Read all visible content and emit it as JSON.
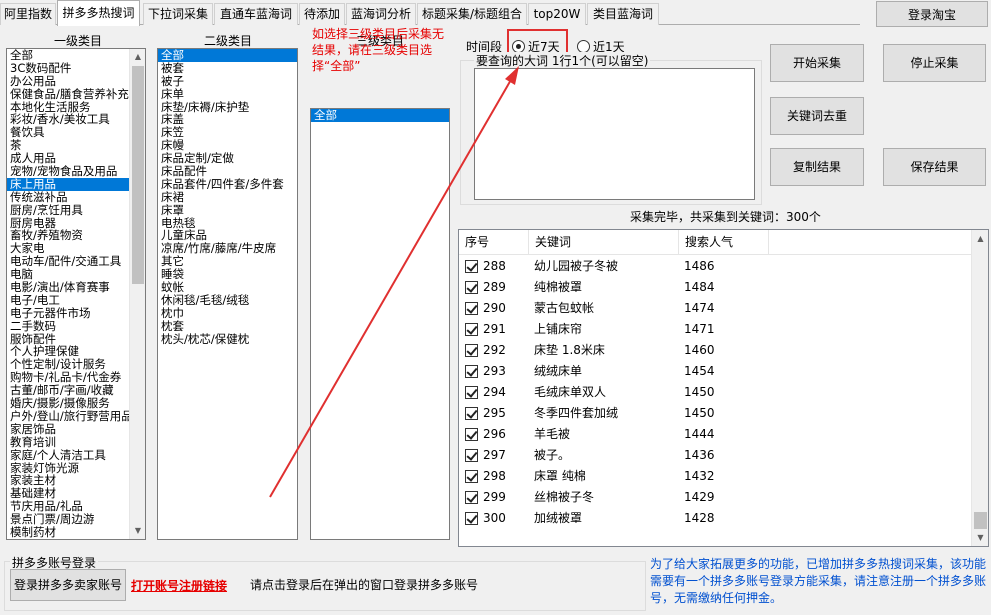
{
  "tabs": [
    "阿里指数",
    "拼多多热搜词",
    "下拉词采集",
    "直通车蓝海词",
    "待添加",
    "蓝海词分析",
    "标题采集/标题组合",
    "top20W",
    "类目蓝海词"
  ],
  "active_tab": 1,
  "login_taobao": "登录淘宝",
  "category": {
    "level1_label": "一级类目",
    "level2_label": "二级类目",
    "level3_label": "三级类目",
    "level1_items": [
      "全部",
      "3C数码配件",
      "办公用品",
      "保健食品/膳食营养补充",
      "本地化生活服务",
      "彩妆/香水/美妆工具",
      "餐饮具",
      "茶",
      "成人用品",
      "宠物/宠物食品及用品",
      "床上用品",
      "传统滋补品",
      "厨房/烹饪用具",
      "厨房电器",
      "畜牧/养殖物资",
      "大家电",
      "电动车/配件/交通工具",
      "电脑",
      "电影/演出/体育赛事",
      "电子/电工",
      "电子元器件市场",
      "二手数码",
      "服饰配件",
      "个人护理保健",
      "个性定制/设计服务",
      "购物卡/礼品卡/代金券",
      "古董/邮币/字画/收藏",
      "婚庆/摄影/摄像服务",
      "户外/登山/旅行野营用品",
      "家居饰品",
      "教育培训",
      "家庭/个人清洁工具",
      "家装灯饰光源",
      "家装主材",
      "基础建材",
      "节庆用品/礼品",
      "景点门票/周边游",
      "模制药材"
    ],
    "level1_selected": 10,
    "level2_items": [
      "全部",
      "被套",
      "被子",
      "床单",
      "床垫/床褥/床护垫",
      "床盖",
      "床笠",
      "床幔",
      "床品定制/定做",
      "床品配件",
      "床品套件/四件套/多件套",
      "床裙",
      "床罩",
      "电热毯",
      "儿童床品",
      "凉席/竹席/藤席/牛皮席",
      "其它",
      "睡袋",
      "蚊帐",
      "休闲毯/毛毯/绒毯",
      "枕巾",
      "枕套",
      "枕头/枕芯/保健枕"
    ],
    "level2_selected": 0,
    "level3_items": [
      "全部"
    ],
    "level3_selected": 0,
    "hint": "如选择三级类目后采集无结果，请在三级类目选择“全部”"
  },
  "time": {
    "label": "时间段",
    "opt1": "近7天",
    "opt2": "近1天",
    "selected": 0
  },
  "query": {
    "title": "要查询的大词 1行1个(可以留空)",
    "value": ""
  },
  "buttons": {
    "start": "开始采集",
    "stop": "停止采集",
    "dedupe": "关键词去重",
    "copy": "复制结果",
    "save": "保存结果"
  },
  "status": "采集完毕，共采集到关键词：300个",
  "table": {
    "headers": [
      "序号",
      "关键词",
      "搜索人气"
    ],
    "rows": [
      {
        "no": "288",
        "kw": "幼儿园被子冬被",
        "pop": "1486"
      },
      {
        "no": "289",
        "kw": "纯棉被罩",
        "pop": "1484"
      },
      {
        "no": "290",
        "kw": "蒙古包蚊帐",
        "pop": "1474"
      },
      {
        "no": "291",
        "kw": "上铺床帘",
        "pop": "1471"
      },
      {
        "no": "292",
        "kw": "床垫 1.8米床",
        "pop": "1460"
      },
      {
        "no": "293",
        "kw": "绒绒床单",
        "pop": "1454"
      },
      {
        "no": "294",
        "kw": "毛绒床单双人",
        "pop": "1450"
      },
      {
        "no": "295",
        "kw": "冬季四件套加绒",
        "pop": "1450"
      },
      {
        "no": "296",
        "kw": "羊毛被",
        "pop": "1444"
      },
      {
        "no": "297",
        "kw": "被子。",
        "pop": "1436"
      },
      {
        "no": "298",
        "kw": "床罩 纯棉",
        "pop": "1432"
      },
      {
        "no": "299",
        "kw": "丝棉被子冬",
        "pop": "1429"
      },
      {
        "no": "300",
        "kw": "加绒被罩",
        "pop": "1428"
      }
    ]
  },
  "account": {
    "title": "拼多多账号登录",
    "login_btn": "登录拼多多卖家账号",
    "register_link": "打开账号注册链接",
    "hint": "请点击登录后在弹出的窗口登录拼多多账号"
  },
  "note": "为了给大家拓展更多的功能，已增加拼多多热搜词采集，该功能需要有一个拼多多账号登录方能采集，请注意注册一个拼多多账号，无需缴纳任何押金。",
  "colors": {
    "selection": "#0078d7",
    "hint_red": "#e60000",
    "note_blue": "#0050d0",
    "arrow_red": "#e03030"
  }
}
